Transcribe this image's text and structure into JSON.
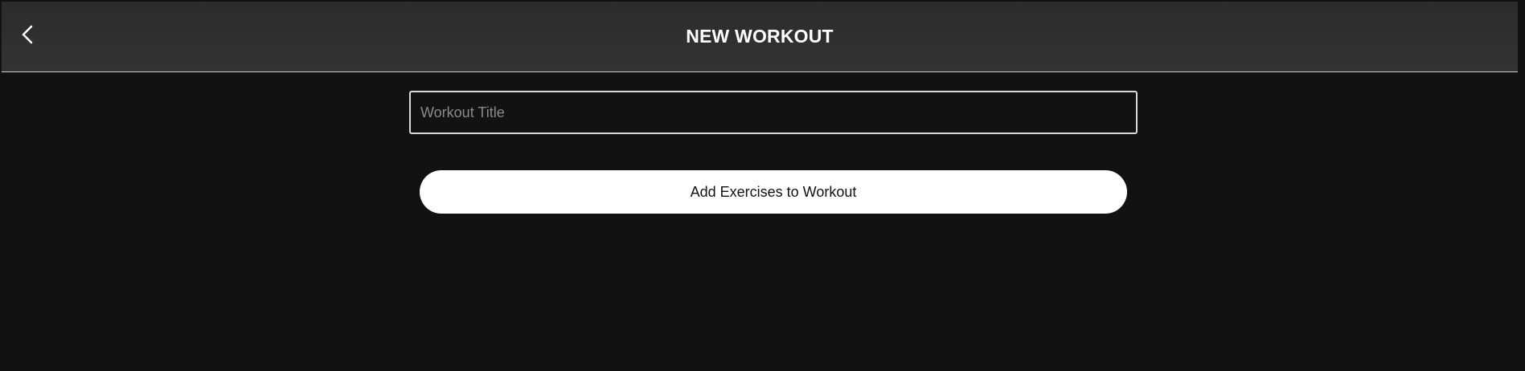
{
  "header": {
    "title": "NEW WORKOUT",
    "back_icon": "chevron-left-icon"
  },
  "form": {
    "title_input": {
      "placeholder": "Workout Title",
      "value": ""
    },
    "add_exercises_label": "Add Exercises to Workout"
  },
  "colors": {
    "background": "#121212",
    "header_background": "#2f2f2f",
    "button_background": "#ffffff",
    "text_primary": "#ffffff"
  }
}
